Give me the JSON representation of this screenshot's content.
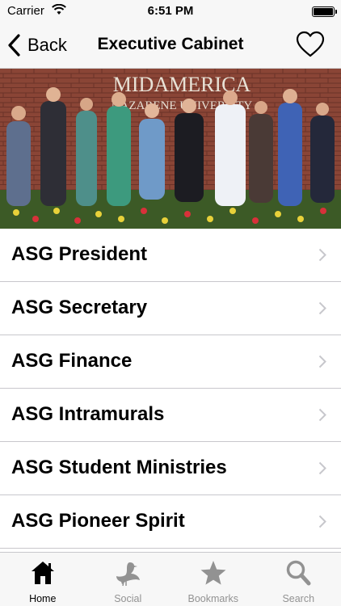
{
  "status_bar": {
    "carrier": "Carrier",
    "time": "6:51 PM"
  },
  "nav": {
    "back_label": "Back",
    "title": "Executive Cabinet"
  },
  "hero": {
    "sign_text_line1": "MIDAMERICA",
    "sign_text_line2": "NAZARENE UNIVERSITY"
  },
  "list": {
    "items": [
      {
        "label": "ASG President"
      },
      {
        "label": "ASG Secretary"
      },
      {
        "label": "ASG Finance"
      },
      {
        "label": "ASG Intramurals"
      },
      {
        "label": "ASG Student Ministries"
      },
      {
        "label": "ASG Pioneer Spirit"
      }
    ]
  },
  "tabs": [
    {
      "label": "Home",
      "icon": "home-icon",
      "active": true
    },
    {
      "label": "Social",
      "icon": "bird-icon",
      "active": false
    },
    {
      "label": "Bookmarks",
      "icon": "star-icon",
      "active": false
    },
    {
      "label": "Search",
      "icon": "search-icon",
      "active": false
    }
  ],
  "colors": {
    "bar_background": "#f7f7f7",
    "inactive_tab": "#929292",
    "separator": "#c8c7cc"
  }
}
